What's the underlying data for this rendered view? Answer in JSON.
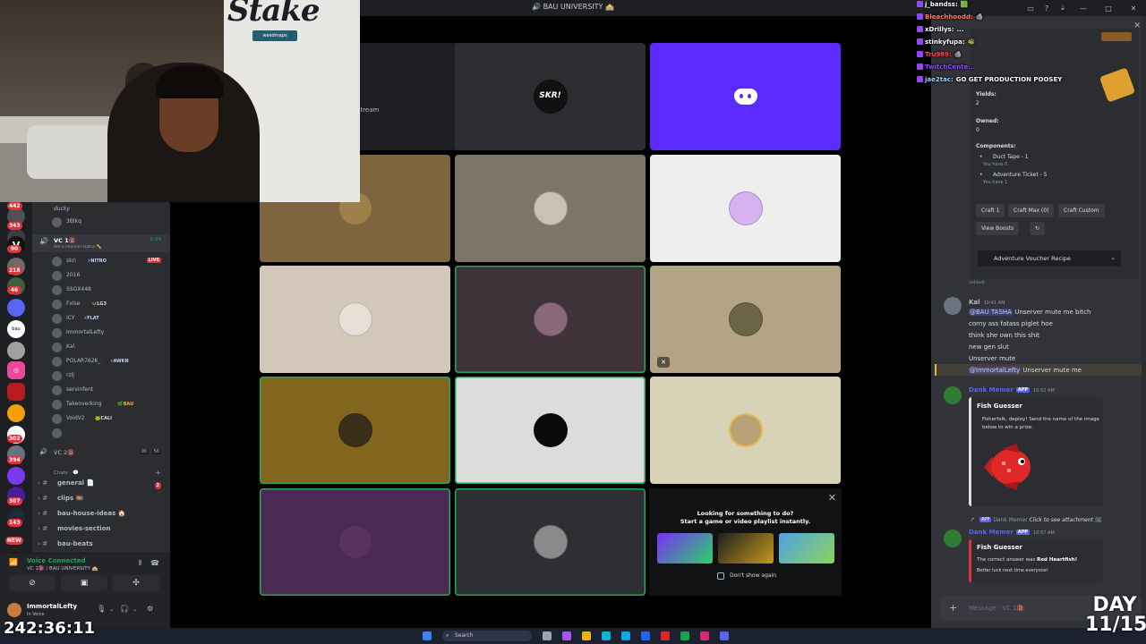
{
  "window": {
    "title": "🔊 BAU UNIVERSITY 🏫"
  },
  "webcam": {
    "sign": "Stake",
    "tv_text": "weedmaps"
  },
  "servers": {
    "badges": [
      "442",
      "343",
      "90",
      "218",
      "46",
      "302",
      "394",
      "307",
      "143",
      "NEW"
    ]
  },
  "channels": {
    "top_user": "ducky",
    "top_user2": "3Blkq",
    "vc1": {
      "name": "VC 1🔞",
      "duration": "0:29",
      "status": "Set a channel status ✏️"
    },
    "members": [
      {
        "name": "skri",
        "tag": "⚡NITRO",
        "tag_color": "#c9cdfb",
        "live": "LIVE"
      },
      {
        "name": "2016"
      },
      {
        "name": "SSGX448"
      },
      {
        "name": "Fxlse",
        "tag": "🦋LG3",
        "tag_color": "#dbdee1"
      },
      {
        "name": "ICY",
        "tag": "⚡FLAT",
        "tag_color": "#c9cdfb"
      },
      {
        "name": "ImmortalLefty"
      },
      {
        "name": "Kal"
      },
      {
        "name": "POLAR762K_",
        "tag": "⚡AWKN",
        "tag_color": "#c9cdfb"
      },
      {
        "name": "rzlj"
      },
      {
        "name": "servinfent"
      },
      {
        "name": "Takeoverking",
        "tag": "🌿BAU",
        "tag_color": "#f0b232"
      },
      {
        "name": "VoidV2",
        "tag": "🐸CALI",
        "tag_color": "#dbdee1"
      },
      {
        "name": ""
      }
    ],
    "vc2": {
      "name": "VC 2🔞",
      "count_a": "00",
      "count_b": "50"
    },
    "category": "Chats · 💬",
    "text_channels": [
      {
        "name": "general 📄",
        "badge": "2"
      },
      {
        "name": "clips 🎞️"
      },
      {
        "name": "bau-house-ideas 🏠"
      },
      {
        "name": "movies-section"
      },
      {
        "name": "bau-beats"
      }
    ]
  },
  "voice": {
    "status": "Voice Connected",
    "channel": "VC 1🔞 / BAU UNIVERSITY 🏫"
  },
  "user": {
    "name": "ImmortalLefty",
    "status": "In Voice"
  },
  "grid": {
    "stream_label": "Stream",
    "skr_text": "SKR!",
    "promo": {
      "title_line1": "Looking for something to do?",
      "title_line2": "Start a game or video playlist instantly.",
      "dont_show": "Don't show again"
    }
  },
  "crafting": {
    "yields_label": "Yields:",
    "yields": "2",
    "owned_label": "Owned:",
    "owned": "0",
    "components_label": "Components:",
    "components": [
      {
        "name": "Duct Tape - 1",
        "have": "You have 0"
      },
      {
        "name": "Adventure Ticket - 5",
        "have": "You have 1"
      }
    ],
    "buttons": [
      "Craft 1",
      "Craft Max (0)",
      "Craft Custom"
    ],
    "view_boosts": "View Boosts",
    "select": "Adventure Voucher Recipe",
    "edited": "(edited)"
  },
  "messages": {
    "kal": {
      "name": "Kal",
      "time": "10:41 AM",
      "lines": [
        "Unserver mute me bitch",
        "corny ass fatass piglet hoe",
        "think she own this shit",
        "new gen slut",
        "Unserver mute",
        "Unserver mute me"
      ],
      "mention1": "@BAU TASHA",
      "mention2": "@ImmortalLefty"
    },
    "dank1": {
      "name": "Dank Memer",
      "app": "APP",
      "time": "10:52 AM",
      "embed_title": "Fish Guesser",
      "embed_text1": "Fisherfolk, deploy! Send the name of the image",
      "embed_text2": "below to win a prize."
    },
    "reply": {
      "name": "Dank Memer",
      "text": "Click to see attachment"
    },
    "dank2": {
      "name": "Dank Memer",
      "app": "APP",
      "time": "10:57 AM",
      "embed_title": "Fish Guesser",
      "embed_text_prefix": "The correct answer was ",
      "answer": "Red Heartfish!",
      "embed_text2": "Better luck next time everyone!"
    }
  },
  "chat_input": {
    "placeholder": "Message · VC 1🔞"
  },
  "twitch_chat": [
    {
      "user": "j_bandss:",
      "msg": "🟩",
      "color": "#ffffff"
    },
    {
      "user": "Bleachhoodd:",
      "msg": "🪨",
      "color": "#ff7f50"
    },
    {
      "user": "xDrillys:",
      "msg": "...",
      "color": "#ffffff"
    },
    {
      "user": "stinkyfupa:",
      "msg": "🐝",
      "color": "#ffffff"
    },
    {
      "user": "Tru989:",
      "msg": "🪨",
      "color": "#ff4a4a"
    },
    {
      "user": "TwitchCente...",
      "msg": "",
      "color": "#9146ff"
    },
    {
      "user": "jae2tac:",
      "msg": "GO GET PRODUCTION POOSEY",
      "color": "#9ad1ff"
    }
  ],
  "overlay": {
    "timer": "242:36:11",
    "day": "DAY",
    "day_count": "11/15"
  },
  "taskbar": {
    "search": "Search"
  },
  "colors": {
    "accent": "#5865f2",
    "speaking": "#23a559",
    "discord_bg": "#313338"
  }
}
